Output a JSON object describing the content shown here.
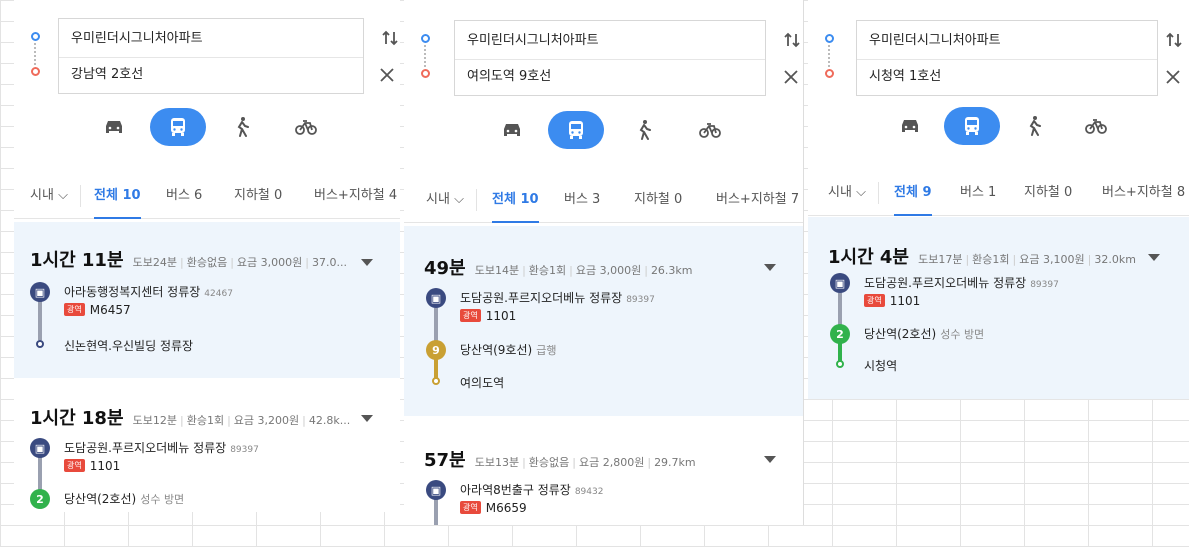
{
  "colors": {
    "accent": "#3c8cf0",
    "bus": "#3a4a80",
    "line2": "#31b24c",
    "line9": "#c9a033",
    "badge": "#e84a3c",
    "selected_bg": "#eef5fc"
  },
  "panels": [
    {
      "origin": "우미린더시그니처아파트",
      "destination": "강남역 2호선",
      "region": "시내",
      "tabs": [
        "전체 10",
        "버스 6",
        "지하철 0",
        "버스+지하철 4"
      ],
      "routes": [
        {
          "time": "1시간 11분",
          "walk": "도보24분",
          "transfer": "환승없음",
          "fare": "요금 3,000원",
          "dist": "37.0...",
          "steps": [
            {
              "icon": "bus",
              "name": "아라동행정복지센터 정류장",
              "id": "42467",
              "badge": "광역",
              "line": "M6457"
            },
            {
              "icon": "end",
              "name": "신논현역.우신빌딩 정류장"
            }
          ]
        },
        {
          "time": "1시간 18분",
          "walk": "도보12분",
          "transfer": "환승1회",
          "fare": "요금 3,200원",
          "dist": "42.8k...",
          "steps": [
            {
              "icon": "bus",
              "name": "도담공원.푸르지오더베뉴 정류장",
              "id": "89397",
              "badge": "광역",
              "line": "1101"
            },
            {
              "icon": "2",
              "name": "당산역(2호선)",
              "sub": "성수 방면"
            }
          ]
        }
      ]
    },
    {
      "origin": "우미린더시그니처아파트",
      "destination": "여의도역 9호선",
      "region": "시내",
      "tabs": [
        "전체 10",
        "버스 3",
        "지하철 0",
        "버스+지하철 7"
      ],
      "routes": [
        {
          "time": "49분",
          "walk": "도보14분",
          "transfer": "환승1회",
          "fare": "요금 3,000원",
          "dist": "26.3km",
          "steps": [
            {
              "icon": "bus",
              "name": "도담공원.푸르지오더베뉴 정류장",
              "id": "89397",
              "badge": "광역",
              "line": "1101"
            },
            {
              "icon": "9",
              "name": "당산역(9호선)",
              "sub": "급행"
            },
            {
              "icon": "end9",
              "name": "여의도역"
            }
          ]
        },
        {
          "time": "57분",
          "walk": "도보13분",
          "transfer": "환승없음",
          "fare": "요금 2,800원",
          "dist": "29.7km",
          "steps": [
            {
              "icon": "bus",
              "name": "아라역8번출구 정류장",
              "id": "89432",
              "badge": "광역",
              "line": "M6659"
            }
          ]
        }
      ]
    },
    {
      "origin": "우미린더시그니처아파트",
      "destination": "시청역 1호선",
      "region": "시내",
      "tabs": [
        "전체 9",
        "버스 1",
        "지하철 0",
        "버스+지하철 8"
      ],
      "routes": [
        {
          "time": "1시간 4분",
          "walk": "도보17분",
          "transfer": "환승1회",
          "fare": "요금 3,100원",
          "dist": "32.0km",
          "steps": [
            {
              "icon": "bus",
              "name": "도담공원.푸르지오더베뉴 정류장",
              "id": "89397",
              "badge": "광역",
              "line": "1101"
            },
            {
              "icon": "2",
              "name": "당산역(2호선)",
              "sub": "성수 방면"
            },
            {
              "icon": "end2",
              "name": "시청역"
            }
          ]
        }
      ]
    }
  ]
}
